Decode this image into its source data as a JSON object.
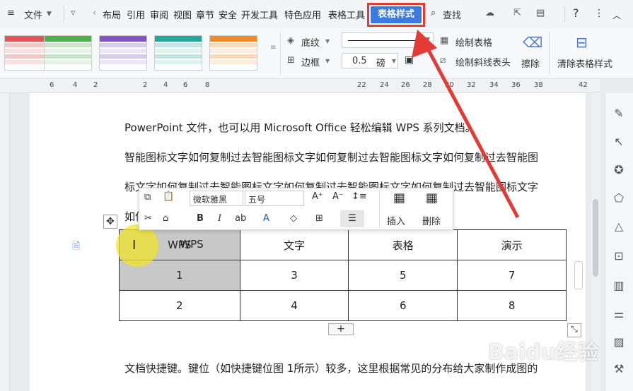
{
  "menubar": {
    "menu_icon": "hamburger-icon",
    "file_label": "文件",
    "tabs": [
      "布局",
      "引用",
      "审阅",
      "视图",
      "章节",
      "安全",
      "开发工具",
      "特色应用",
      "表格工具"
    ],
    "active_tab": "表格样式",
    "search_label": "查找",
    "help": "?"
  },
  "ribbon": {
    "shading_label": "底纹",
    "border_label": "边框",
    "line_width": "0.5",
    "line_unit": "磅",
    "draw_table": "绘制表格",
    "draw_diagonal": "绘制斜线表头",
    "erase": "擦除",
    "clear_style": "清除表格样式",
    "style_colors": [
      "#e05555",
      "#4caf50",
      "#7e57c2",
      "#26a69a",
      "#ef8b2c"
    ]
  },
  "ruler": {
    "numbers": [
      "6",
      "4",
      "2",
      "2",
      "4",
      "6",
      "8",
      "22",
      "24",
      "26",
      "28",
      "30",
      "32",
      "34",
      "36",
      "38",
      "42"
    ]
  },
  "document": {
    "line1": "PowerPoint 文件，也可以用 Microsoft Office 轻松编辑 WPS 系列文档。",
    "line2": "智能图标文字如何复制过去智能图标文字如何复制过去智能图标文字如何复制过去智能图",
    "line3": "标文字如何复制过去智能图标文字如何复制过去智能图标文字如何复制过去智能图标文字",
    "line4_prefix": "如何",
    "footer": "文档快捷键。键位（如快捷键位图 1所示）较多，这里根据常见的分布给大家制作成图的"
  },
  "float_toolbar": {
    "font": "微软雅黑",
    "size": "五号",
    "insert": "插入",
    "delete": "删除"
  },
  "table": {
    "rows": [
      [
        "WPS",
        "文字",
        "表格",
        "演示"
      ],
      [
        "1",
        "3",
        "5",
        "7"
      ],
      [
        "2",
        "4",
        "6",
        "8"
      ]
    ]
  },
  "add_row": "+",
  "watermark": "Baidu经验",
  "colors": {
    "accent": "#3b7ae0",
    "highlight": "#e53935"
  }
}
